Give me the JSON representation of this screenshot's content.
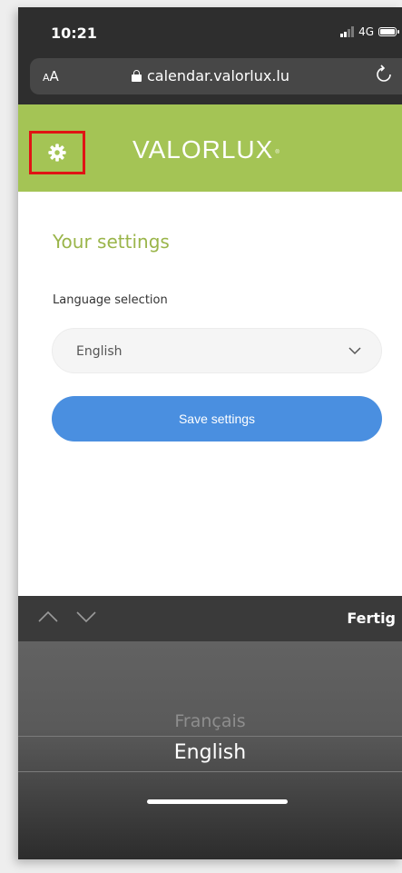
{
  "status_bar": {
    "time": "10:21",
    "network": "4G"
  },
  "browser": {
    "text_size_small": "A",
    "text_size_large": "A",
    "url": "calendar.valorlux.lu"
  },
  "header": {
    "logo": "VALORLUX",
    "brand_color": "#a4c455",
    "settings_icon": "gear-icon",
    "highlight_color": "#e01414"
  },
  "main": {
    "title": "Your settings",
    "language_label": "Language selection",
    "language_value": "English",
    "save_label": "Save settings",
    "accent_color": "#4a8fe0"
  },
  "keyboard_bar": {
    "done_label": "Fertig"
  },
  "picker": {
    "options": [
      "Français",
      "English"
    ],
    "selected": "English"
  }
}
